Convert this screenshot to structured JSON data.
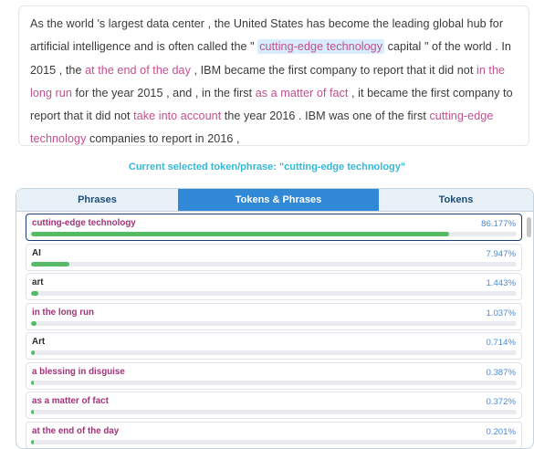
{
  "passage": [
    {
      "text": "As the world 's largest data center , the United States has become the leading global hub for artificial intelligence and is often called the \" ",
      "kind": "text"
    },
    {
      "text": "cutting-edge technology",
      "kind": "selected"
    },
    {
      "text": " capital \" of the world . In 2015 , the ",
      "kind": "text"
    },
    {
      "text": "at the end of the day",
      "kind": "phrase"
    },
    {
      "text": " , IBM became the first company to report that it did not ",
      "kind": "text"
    },
    {
      "text": "in the long run",
      "kind": "phrase"
    },
    {
      "text": " for the year 2015 , and , in the first ",
      "kind": "text"
    },
    {
      "text": "as a matter of fact",
      "kind": "phrase"
    },
    {
      "text": " , it became the first company to report that it did not ",
      "kind": "text"
    },
    {
      "text": "take into account",
      "kind": "phrase"
    },
    {
      "text": " the year 2016 . IBM was one of the first ",
      "kind": "text"
    },
    {
      "text": "cutting-edge technology",
      "kind": "phrase"
    },
    {
      "text": " companies to report in 2016 ,",
      "kind": "text"
    }
  ],
  "current_selection": "Current selected token/phrase: \"cutting-edge technology\"",
  "tabs": {
    "phrases": "Phrases",
    "tokens_phrases": "Tokens & Phrases",
    "tokens": "Tokens"
  },
  "items": [
    {
      "label": "cutting-edge technology",
      "percent": "86.177%",
      "fill": 0.86177,
      "kind": "phrase",
      "selected": true
    },
    {
      "label": "AI",
      "percent": "7.947%",
      "fill": 0.07947,
      "kind": "token"
    },
    {
      "label": "art",
      "percent": "1.443%",
      "fill": 0.01443,
      "kind": "token"
    },
    {
      "label": "in the long run",
      "percent": "1.037%",
      "fill": 0.01037,
      "kind": "phrase"
    },
    {
      "label": "Art",
      "percent": "0.714%",
      "fill": 0.00714,
      "kind": "token"
    },
    {
      "label": "a blessing in disguise",
      "percent": "0.387%",
      "fill": 0.00387,
      "kind": "phrase"
    },
    {
      "label": "as a matter of fact",
      "percent": "0.372%",
      "fill": 0.00372,
      "kind": "phrase"
    },
    {
      "label": "at the end of the day",
      "percent": "0.201%",
      "fill": 0.00201,
      "kind": "phrase"
    }
  ],
  "colors": {
    "phrase": "#c2508e",
    "accent_tab": "#3188d6",
    "bar": "#55bb66",
    "percent": "#4a8ad4",
    "caption": "#35b8d5"
  }
}
